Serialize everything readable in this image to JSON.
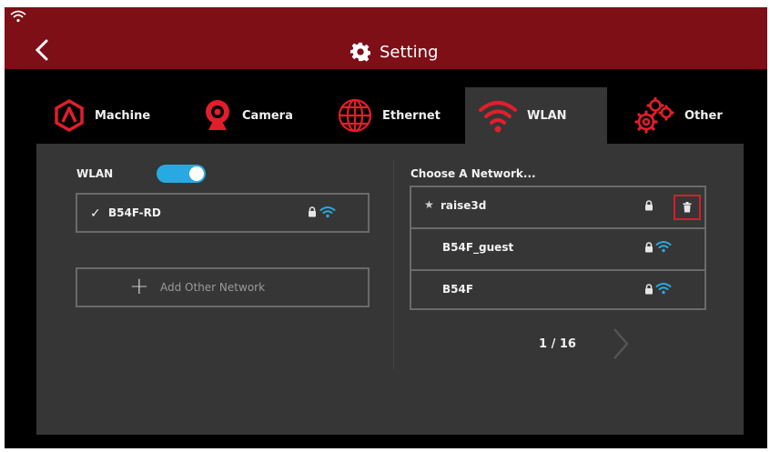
{
  "header": {
    "title": "Setting",
    "back_icon": "chevron-left-icon",
    "title_icon": "gear-icon"
  },
  "status_bar": {
    "icon": "wifi-icon"
  },
  "tabs": [
    {
      "label": "Machine",
      "icon": "machine-logo-icon",
      "active": false
    },
    {
      "label": "Camera",
      "icon": "camera-icon",
      "active": false
    },
    {
      "label": "Ethernet",
      "icon": "globe-icon",
      "active": false
    },
    {
      "label": "WLAN",
      "icon": "wifi-icon",
      "active": true
    },
    {
      "label": "Other",
      "icon": "gears-icon",
      "active": false
    }
  ],
  "wlan": {
    "label": "WLAN",
    "enabled": true,
    "connected_network": {
      "name": "B54F-RD",
      "secured": true
    },
    "add_network_label": "Add Other Network"
  },
  "networks": {
    "heading": "Choose A Network...",
    "items": [
      {
        "name": "raise3d",
        "saved": true,
        "secured": true
      },
      {
        "name": "B54F_guest",
        "saved": false,
        "secured": true
      },
      {
        "name": "B54F",
        "saved": false,
        "secured": true
      }
    ],
    "page": "1 / 16"
  },
  "colors": {
    "header": "#7e0f17",
    "accent_red": "#d51f2b",
    "toggle_blue": "#29a9e1",
    "panel": "#363636",
    "background": "#000000"
  }
}
